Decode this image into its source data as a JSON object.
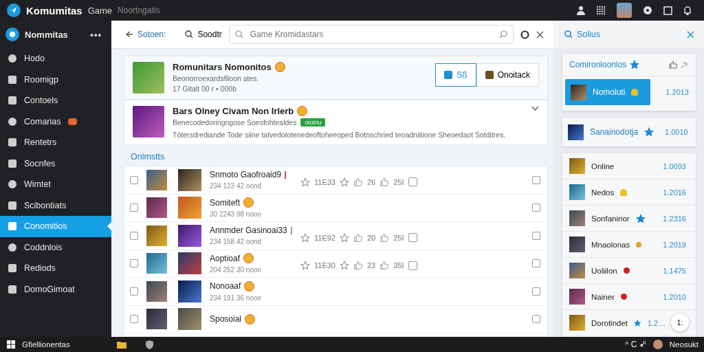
{
  "titlebar": {
    "app_name": "Komumitas",
    "section": "Game",
    "subtitle": "Noortngatis"
  },
  "sidebar": {
    "title": "Nommitas",
    "more": "•••",
    "items": [
      {
        "label": "Hodo",
        "selected": false,
        "badge": false
      },
      {
        "label": "Roomigp",
        "selected": false,
        "badge": false
      },
      {
        "label": "Contoels",
        "selected": false,
        "badge": false
      },
      {
        "label": "Comarias",
        "selected": false,
        "badge": true
      },
      {
        "label": "Rentetrs",
        "selected": false,
        "badge": false
      },
      {
        "label": "Socnfes",
        "selected": false,
        "badge": false
      },
      {
        "label": "Wimtet",
        "selected": false,
        "badge": false
      },
      {
        "label": "Scibontiats",
        "selected": false,
        "badge": false
      },
      {
        "label": "Conomitios",
        "selected": true,
        "badge": false
      },
      {
        "label": "Coddnlois",
        "selected": false,
        "badge": false
      },
      {
        "label": "Rediods",
        "selected": false,
        "badge": false
      },
      {
        "label": "DomoGimoat",
        "selected": false,
        "badge": false
      }
    ]
  },
  "toolbar": {
    "back": "Sotoen:",
    "search_label": "Soodtr",
    "search": {
      "placeholder": "Game Kromidastars"
    }
  },
  "featured": {
    "title": "Romunitars Nomonitos",
    "subtitle": "Beonorroexardsfiloon ates.",
    "meta": "17 Gitalt 00 r • 000b",
    "buttons": [
      {
        "label": "Sß",
        "selected": true
      },
      {
        "label": "Onoitack",
        "selected": false
      }
    ]
  },
  "detail": {
    "title": "Bars Olney Civam Non Irlerb",
    "subtitle": "Benecodedoringngose Soesfohtealdes",
    "tag": "oioinu",
    "description": "Tötersdrediande Tode siine tatvedolotenedeoftoheeoped Botnschried teoadniitione Sheoedaot Sotditres."
  },
  "list": {
    "heading": "Onlmstts",
    "rows": [
      {
        "title": "Snmoto Gaofroaid9",
        "kind": "red-box",
        "meta": "234 123 42 oond",
        "stats": [
          "11E33",
          "26",
          "25I"
        ],
        "checked": false,
        "flag": false
      },
      {
        "title": "Somiteft",
        "kind": "emoji",
        "meta": "30 2243 98 nooo",
        "stats": [],
        "checked": false,
        "flag": false
      },
      {
        "title": "Annmder Gasinoai33",
        "kind": "grey-box",
        "meta": "234 158 42 oond",
        "stats": [
          "11E92",
          "20",
          "25I"
        ],
        "checked": false,
        "flag": false
      },
      {
        "title": "Aoptioaf",
        "kind": "emoji",
        "meta": "204 252 30 nooo",
        "stats": [
          "11E30",
          "23",
          "35I"
        ],
        "checked": false,
        "flag": false
      },
      {
        "title": "Nonoaaf",
        "kind": "emoji",
        "meta": "234 191 36 nooe",
        "stats": [],
        "checked": false,
        "flag": false
      },
      {
        "title": "Sposoial",
        "kind": "emoji",
        "meta": "",
        "stats": [],
        "checked": false,
        "flag": false
      }
    ]
  },
  "right_panel": {
    "title": "Solius",
    "featured": {
      "title": "Comironloonlos",
      "items": [
        {
          "name": "Nomoluti",
          "value": "1.2013",
          "kind": "bell",
          "selected": true
        }
      ]
    },
    "second": {
      "items": [
        {
          "name": "Sanainodotja",
          "value": "1.0010",
          "kind": "star",
          "selected": false
        }
      ]
    },
    "list": [
      {
        "name": "Online",
        "value": "1.0093",
        "kind": "plain",
        "selected": false
      },
      {
        "name": "Nedos",
        "value": "1.2016",
        "kind": "bell",
        "selected": false
      },
      {
        "name": "Sonfanirior",
        "value": "1.2316",
        "kind": "star",
        "selected": false
      },
      {
        "name": "Mnaolonas",
        "value": "1.2019",
        "kind": "dot",
        "selected": false
      },
      {
        "name": "Uoliilon",
        "value": "1.1475",
        "kind": "red",
        "selected": false
      },
      {
        "name": "Nainer",
        "value": "1.2010",
        "kind": "red",
        "selected": false
      },
      {
        "name": "Dorotindet",
        "value": "1.2…",
        "kind": "star",
        "selected": false
      }
    ],
    "fab": "1:"
  },
  "taskbar": {
    "start": "Gfiellionentas",
    "tray": "^ Ꮯ ◂ᐦ",
    "user": "Neosukt"
  }
}
